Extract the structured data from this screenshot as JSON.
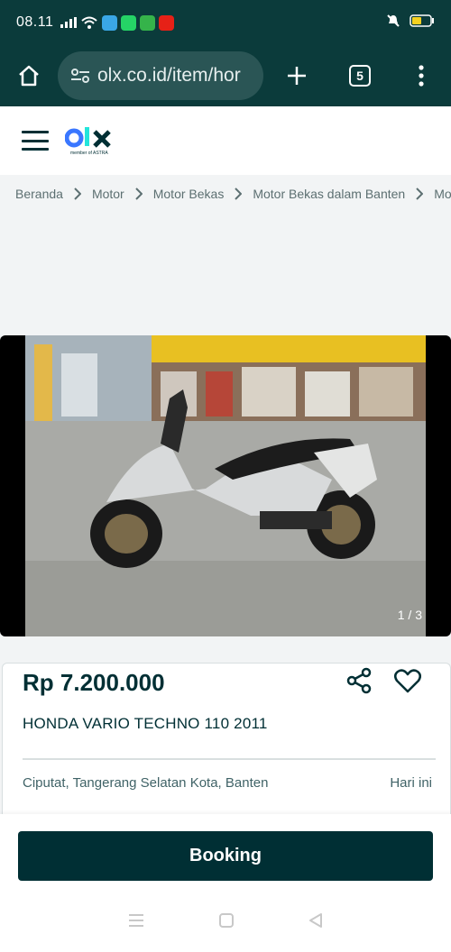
{
  "status_bar": {
    "time": "08.11",
    "icons": [
      "signal-icon",
      "wifi-icon",
      "app-icon",
      "whatsapp-icon",
      "app-icon",
      "youtube-icon",
      "mute-icon",
      "battery-icon"
    ]
  },
  "browser": {
    "url": "olx.co.id/item/hor",
    "tab_count": "5"
  },
  "site": {
    "logo_text": "olx",
    "logo_sub": "member of ASTRA"
  },
  "breadcrumb": {
    "items": [
      "Beranda",
      "Motor",
      "Motor Bekas",
      "Motor Bekas dalam Banten",
      "Moto"
    ]
  },
  "gallery": {
    "counter": "1 / 3"
  },
  "listing": {
    "price": "Rp 7.200.000",
    "title": "HONDA VARIO TECHNO 110 2011",
    "location": "Ciputat, Tangerang Selatan Kota, Banten",
    "posted": "Hari ini"
  },
  "booking": {
    "label": "Booking"
  },
  "colors": {
    "brand_dark": "#002f34",
    "browser_bar": "#0b3b3b",
    "logo_blue": "#3a77ff",
    "logo_green": "#23e5db"
  }
}
